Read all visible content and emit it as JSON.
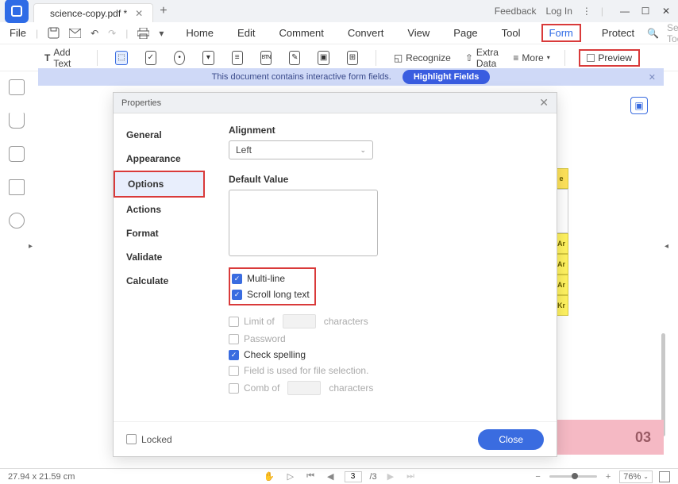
{
  "titlebar": {
    "tab_title": "science-copy.pdf *",
    "feedback": "Feedback",
    "login": "Log In"
  },
  "menubar": {
    "file": "File",
    "items": [
      "Home",
      "Edit",
      "Comment",
      "Convert",
      "View",
      "Page",
      "Tool",
      "Form",
      "Protect"
    ],
    "search_ph": "Search Tools"
  },
  "toolbar": {
    "add_text": "Add Text",
    "recognize": "Recognize",
    "extra_data": "Extra Data",
    "more": "More",
    "preview": "Preview"
  },
  "banner": {
    "msg": "This document contains interactive form fields.",
    "button": "Highlight Fields"
  },
  "periodic": {
    "header": "e",
    "cells": [
      "Ar",
      "Ar",
      "Ar",
      "Kr"
    ]
  },
  "page_badge": "03",
  "dialog": {
    "title": "Properties",
    "tabs": [
      "General",
      "Appearance",
      "Options",
      "Actions",
      "Format",
      "Validate",
      "Calculate"
    ],
    "alignment_label": "Alignment",
    "alignment_value": "Left",
    "default_value_label": "Default Value",
    "multi_line": "Multi-line",
    "scroll_long": "Scroll long text",
    "limit_of": "Limit of",
    "characters": "characters",
    "password": "Password",
    "check_spelling": "Check spelling",
    "file_selection": "Field is used for file selection.",
    "comb_of": "Comb of",
    "locked": "Locked",
    "close": "Close"
  },
  "status": {
    "dimensions": "27.94 x 21.59 cm",
    "page_current": "3",
    "page_total": "/3",
    "zoom": "76%"
  },
  "chart_data": null
}
